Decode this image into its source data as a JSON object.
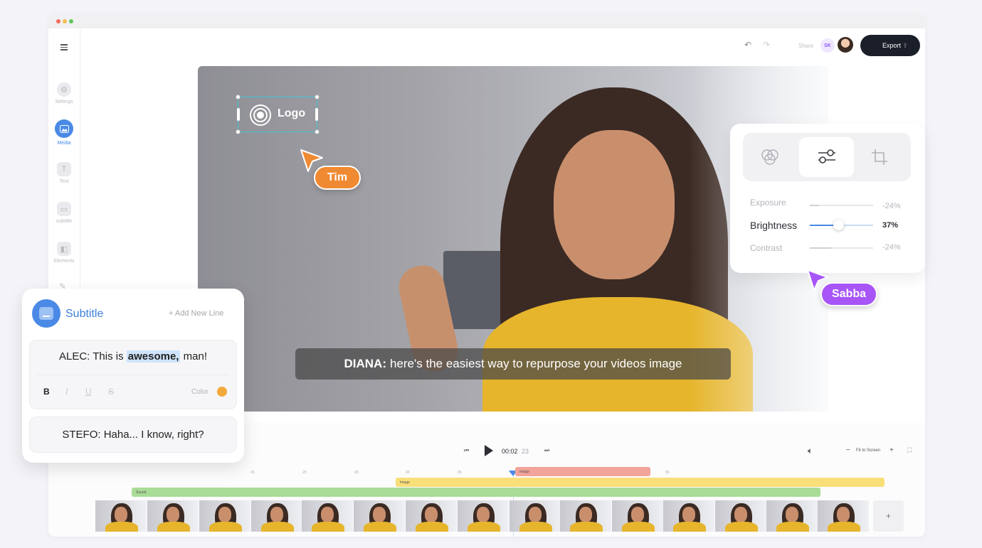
{
  "sidebar": {
    "menu_icon": "hamburger-icon",
    "items": [
      {
        "label": "Settings",
        "icon": "gear-icon"
      },
      {
        "label": "Media",
        "icon": "image-icon",
        "active": true
      },
      {
        "label": "Text",
        "icon": "text-icon"
      },
      {
        "label": "subtitle",
        "icon": "subtitle-icon"
      },
      {
        "label": "Elements",
        "icon": "elements-icon"
      }
    ]
  },
  "topbar": {
    "undo": "↶",
    "redo": "↷",
    "share": "Share",
    "avatar_initials": "SK",
    "export": "Export"
  },
  "canvas": {
    "logo_label": "Logo",
    "caption_speaker": "DIANA:",
    "caption_text": "here's the easiest way to repurpose your videos image"
  },
  "collaborators": [
    {
      "name": "Tim",
      "color": "#f08a32"
    },
    {
      "name": "Sabba",
      "color": "#a855f7"
    }
  ],
  "adjust_panel": {
    "tabs": [
      "color-icon",
      "sliders-icon",
      "crop-icon"
    ],
    "active_tab": 1,
    "sliders": [
      {
        "label": "Exposure",
        "value": "-24%",
        "level": 0.15
      },
      {
        "label": "Brightness",
        "value": "37%",
        "level": 0.45
      },
      {
        "label": "Contrast",
        "value": "-24%",
        "level": 0.33
      }
    ]
  },
  "subtitle_panel": {
    "title": "Subtitle",
    "add_line": "+ Add New Line",
    "line1_prefix": "ALEC: This is",
    "line1_highlight": "awesome,",
    "line1_suffix": "man!",
    "format": {
      "bold": "B",
      "italic": "I",
      "underline": "U",
      "strike": "S",
      "color_label": "Color",
      "color": "#f4a93b"
    },
    "line2": "STEFO: Haha... I know, right?"
  },
  "timeline": {
    "time_current": "00:02",
    "time_frames": "23",
    "fit_label": "Fit to Screen",
    "minus": "−",
    "plus": "+",
    "ruler": [
      "15",
      "20",
      "25",
      "30",
      "35",
      "40",
      "45",
      "50",
      "55"
    ],
    "tracks": [
      {
        "label": "Image",
        "color": "#f2a39a"
      },
      {
        "label": "Image",
        "color": "#f9df7a"
      },
      {
        "label": "Sound",
        "color": "#a9dc96"
      }
    ],
    "add_clip": "+"
  }
}
